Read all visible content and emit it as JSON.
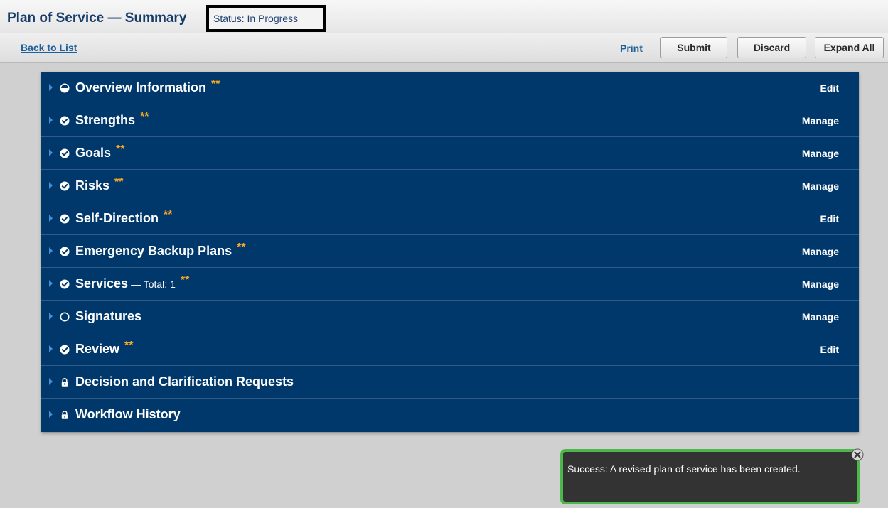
{
  "header": {
    "title": "Plan of Service — Summary",
    "status": "Status: In Progress"
  },
  "toolbar": {
    "back_label": "Back to List",
    "print_label": "Print",
    "submit_label": "Submit",
    "discard_label": "Discard",
    "expand_label": "Expand All"
  },
  "sections": [
    {
      "label": "Overview Information",
      "extra": "",
      "stars": "**",
      "action": "Edit",
      "icon": "half-circle-icon"
    },
    {
      "label": "Strengths",
      "extra": "",
      "stars": "**",
      "action": "Manage",
      "icon": "check-circle-icon"
    },
    {
      "label": "Goals",
      "extra": "",
      "stars": "**",
      "action": "Manage",
      "icon": "check-circle-icon"
    },
    {
      "label": "Risks",
      "extra": "",
      "stars": "**",
      "action": "Manage",
      "icon": "check-circle-icon"
    },
    {
      "label": "Self-Direction",
      "extra": "",
      "stars": "**",
      "action": "Edit",
      "icon": "check-circle-icon"
    },
    {
      "label": "Emergency Backup Plans",
      "extra": "",
      "stars": "**",
      "action": "Manage",
      "icon": "check-circle-icon"
    },
    {
      "label": "Services",
      "extra": "— Total: 1",
      "stars": "**",
      "action": "Manage",
      "icon": "check-circle-icon"
    },
    {
      "label": "Signatures",
      "extra": "",
      "stars": "",
      "action": "Manage",
      "icon": "empty-circle-icon"
    },
    {
      "label": "Review",
      "extra": "",
      "stars": "**",
      "action": "Edit",
      "icon": "check-circle-icon"
    },
    {
      "label": "Decision and Clarification Requests",
      "extra": "",
      "stars": "",
      "action": "",
      "icon": "lock-icon"
    },
    {
      "label": "Workflow History",
      "extra": "",
      "stars": "",
      "action": "",
      "icon": "lock-icon"
    }
  ],
  "toast": {
    "message": "Success: A revised plan of service has been created."
  },
  "colors": {
    "panel": "#00386b",
    "stars": "#f5a623",
    "toast_border": "#4cb84c"
  }
}
